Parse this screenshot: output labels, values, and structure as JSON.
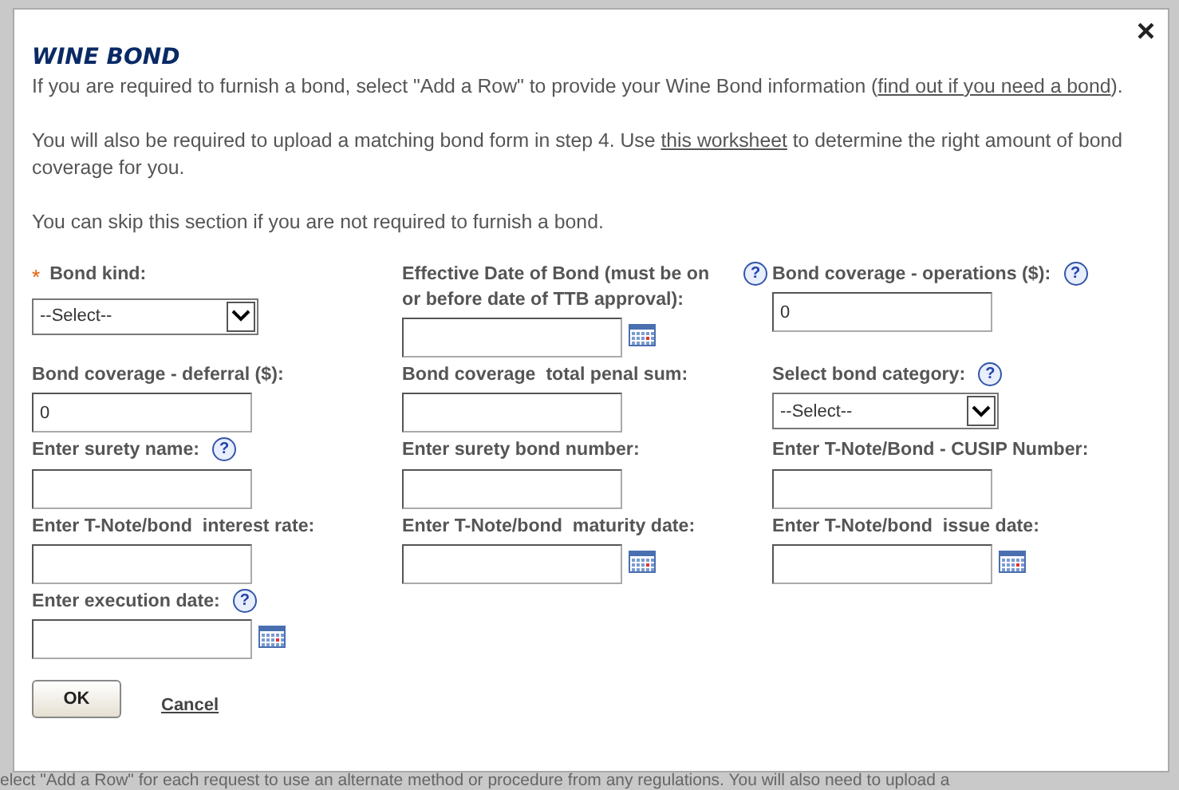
{
  "background_text": "elect \"Add a Row\" for each request to use an alternate method or procedure from any regulations. You will also need to upload a",
  "dialog": {
    "close": "×",
    "title": "WINE BOND",
    "paragraphs": [
      {
        "parts": [
          {
            "text": "If you are required to furnish a bond, select \"Add a Row\" to provide your Wine Bond information ("
          },
          {
            "text": "find out if you need a bond",
            "kind": "link"
          },
          {
            "text": ")."
          }
        ]
      },
      {
        "parts": [
          {
            "text": "You will also be required to upload a matching bond form in step 4. Use "
          },
          {
            "text": "this worksheet",
            "kind": "link"
          },
          {
            "text": " to determine the right amount of bond coverage for you."
          }
        ]
      },
      {
        "parts": [
          {
            "text": "You can skip this section if you are not required to furnish a bond."
          }
        ]
      }
    ],
    "fields": [
      {
        "kind": "select",
        "label": "Bond kind:",
        "required_mark": "*",
        "value": "--Select--"
      },
      {
        "kind": "date",
        "label": "Effective Date of Bond (must be on or before date of TTB approval):",
        "help": "?"
      },
      {
        "kind": "text",
        "label": "Bond coverage - operations ($):",
        "help": "?",
        "value": "0"
      },
      {
        "kind": "text",
        "label": "Bond coverage - deferral ($):",
        "value": "0"
      },
      {
        "kind": "text",
        "label": "Bond coverage  total penal sum:"
      },
      {
        "kind": "select",
        "label": "Select bond category:",
        "help": "?",
        "value": "--Select--"
      },
      {
        "kind": "text",
        "label": "Enter surety name:",
        "help": "?"
      },
      {
        "kind": "text",
        "label": "Enter surety bond number:"
      },
      {
        "kind": "text",
        "label": "Enter T-Note/Bond - CUSIP Number:"
      },
      {
        "kind": "text",
        "label": "Enter T-Note/bond  interest rate:"
      },
      {
        "kind": "date",
        "label": "Enter T-Note/bond  maturity date:"
      },
      {
        "kind": "date",
        "label": "Enter T-Note/bond  issue date:"
      },
      {
        "kind": "date",
        "label": "Enter execution date:",
        "help": "?"
      }
    ],
    "ok": "OK",
    "cancel": "Cancel"
  }
}
